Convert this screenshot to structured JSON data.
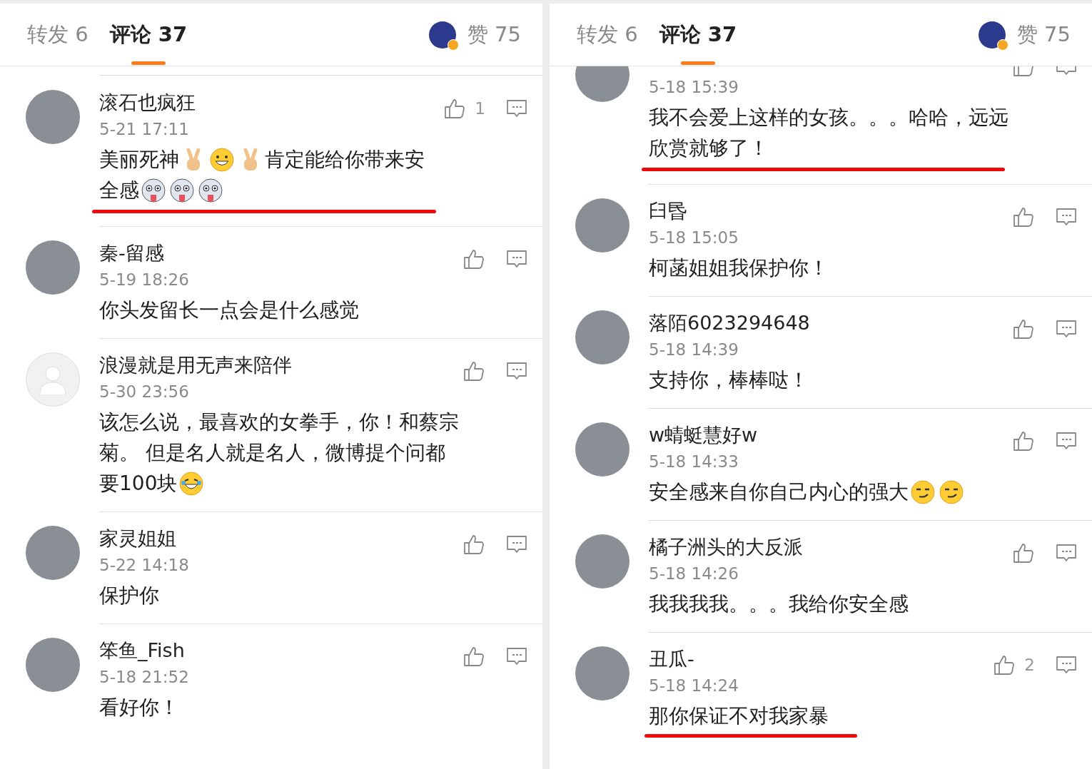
{
  "panels": [
    {
      "tabs": [
        {
          "label": "转发 6",
          "selected": false
        },
        {
          "label": "评论 37",
          "selected": true
        }
      ],
      "likes_label": "赞 75",
      "cut_first": false,
      "comments": [
        {
          "name": "滚石也疯狂",
          "time": "5-21 17:11",
          "likes": "1",
          "underlined": true,
          "underline_text_only": false,
          "body": [
            {
              "kind": "text",
              "text": "美丽死神"
            },
            {
              "kind": "victory"
            },
            {
              "kind": "grin"
            },
            {
              "kind": "victory"
            },
            {
              "kind": "text",
              "text": "肯定能给你带来安全感"
            },
            {
              "kind": "dog"
            },
            {
              "kind": "dog"
            },
            {
              "kind": "dog"
            }
          ]
        },
        {
          "name": "秦-留感",
          "time": "5-19 18:26",
          "underlined": false,
          "body": [
            {
              "kind": "text",
              "text": "你头发留长一点会是什么感觉"
            }
          ]
        },
        {
          "name": "浪漫就是用无声来陪伴",
          "time": "5-30 23:56",
          "underlined": false,
          "default_avatar": true,
          "body": [
            {
              "kind": "text",
              "text": "该怎么说，最喜欢的女拳手，你！和蔡宗菊。 但是名人就是名人，微博提个问都要100块"
            },
            {
              "kind": "laugh"
            }
          ]
        },
        {
          "name": "家灵姐姐",
          "time": "5-22 14:18",
          "underlined": false,
          "body": [
            {
              "kind": "text",
              "text": "保护你"
            }
          ]
        },
        {
          "name": "笨鱼_Fish",
          "time": "5-18 21:52",
          "underlined": false,
          "body": [
            {
              "kind": "text",
              "text": "看好你！"
            }
          ]
        }
      ]
    },
    {
      "tabs": [
        {
          "label": "转发 6",
          "selected": false
        },
        {
          "label": "评论 37",
          "selected": true
        }
      ],
      "likes_label": "赞 75",
      "cut_first": true,
      "comments": [
        {
          "time": "5-18 15:39",
          "underlined": true,
          "underline_text_only": false,
          "body": [
            {
              "kind": "text",
              "text": "我不会爱上这样的女孩。。。哈哈，远远欣赏就够了！"
            }
          ]
        },
        {
          "name": "臼昬",
          "time": "5-18 15:05",
          "underlined": false,
          "body": [
            {
              "kind": "text",
              "text": "柯菡姐姐我保护你！"
            }
          ]
        },
        {
          "name": "落陌6023294648",
          "time": "5-18 14:39",
          "underlined": false,
          "body": [
            {
              "kind": "text",
              "text": "支持你，棒棒哒！"
            }
          ]
        },
        {
          "name": "w蜻蜓慧好w",
          "time": "5-18 14:33",
          "underlined": false,
          "body": [
            {
              "kind": "text",
              "text": "安全感来自你自己内心的强大"
            },
            {
              "kind": "smirk"
            },
            {
              "kind": "smirk"
            }
          ]
        },
        {
          "name": "橘子洲头的大反派",
          "time": "5-18 14:26",
          "underlined": false,
          "body": [
            {
              "kind": "text",
              "text": "我我我我。。。我给你安全感"
            }
          ]
        },
        {
          "name": "丑瓜-",
          "time": "5-18 14:24",
          "likes": "2",
          "underlined": true,
          "underline_text_only": true,
          "body": [
            {
              "kind": "text",
              "text": "那你保证不对我家暴"
            }
          ]
        }
      ]
    }
  ]
}
